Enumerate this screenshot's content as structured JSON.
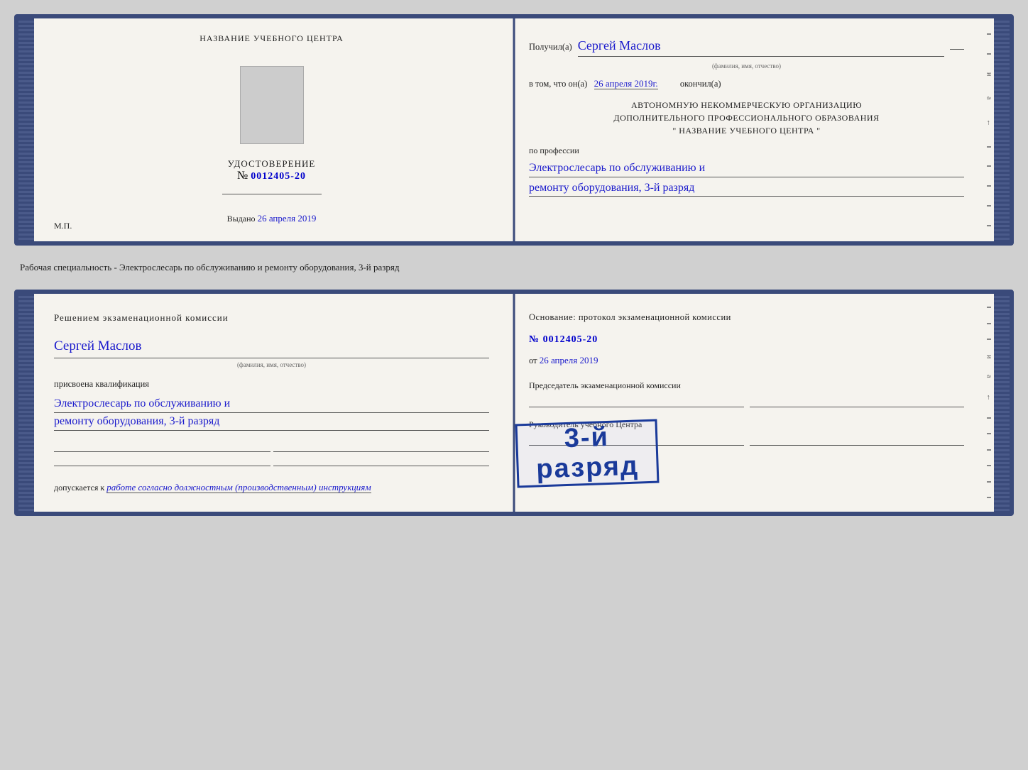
{
  "card1": {
    "left": {
      "title": "НАЗВАНИЕ УЧЕБНОГО ЦЕНТРА",
      "cert_label": "УДОСТОВЕРЕНИЕ",
      "cert_number_prefix": "№",
      "cert_number": "0012405-20",
      "issued_label": "Выдано",
      "issued_date": "26 апреля 2019",
      "mp_label": "М.П."
    },
    "right": {
      "received_label": "Получил(а)",
      "recipient_name": "Сергей Маслов",
      "fio_sub": "(фамилия, имя, отчество)",
      "in_that_label": "в том, что он(а)",
      "date_value": "26 апреля 2019г.",
      "finished_label": "окончил(а)",
      "org_line1": "АВТОНОМНУЮ НЕКОММЕРЧЕСКУЮ ОРГАНИЗАЦИЮ",
      "org_line2": "ДОПОЛНИТЕЛЬНОГО ПРОФЕССИОНАЛЬНОГО ОБРАЗОВАНИЯ",
      "org_line3": "\"   НАЗВАНИЕ УЧЕБНОГО ЦЕНТРА   \"",
      "profession_label": "по профессии",
      "profession_line1": "Электрослесарь по обслуживанию и",
      "profession_line2": "ремонту оборудования, 3-й разряд"
    }
  },
  "between_text": "Рабочая специальность - Электрослесарь по обслуживанию и ремонту оборудования, 3-й разряд",
  "card2": {
    "left": {
      "decision_title": "Решением  экзаменационной  комиссии",
      "name": "Сергей Маслов",
      "fio_sub": "(фамилия, имя, отчество)",
      "assigned_label": "присвоена квалификация",
      "profession_line1": "Электрослесарь по обслуживанию и",
      "profession_line2": "ремонту оборудования, 3-й разряд",
      "allows_label": "допускается к",
      "allows_value": "работе согласно должностным (производственным) инструкциям"
    },
    "right": {
      "basis_title": "Основание: протокол экзаменационной  комиссии",
      "number_prefix": "№",
      "number": "0012405-20",
      "date_prefix": "от",
      "date": "26 апреля 2019",
      "chairman_label": "Председатель экзаменационной комиссии",
      "head_label": "Руководитель учебного Центра"
    },
    "stamp": {
      "line1": "3-й разряд"
    }
  }
}
